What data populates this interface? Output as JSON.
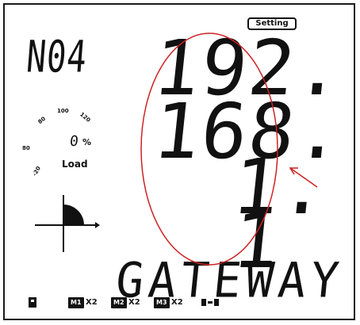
{
  "display": {
    "setting_badge": "Setting",
    "device_id": "N04",
    "ip_octets": [
      "192.",
      "168.",
      "1.",
      "1"
    ],
    "parameter_label": "GATEWAY"
  },
  "load_gauge": {
    "scale_labels": [
      "-20",
      "80",
      "80",
      "100",
      "120"
    ],
    "value": "0",
    "unit": "%",
    "label": "Load",
    "ring_color": "#cc2222"
  },
  "status_bar": {
    "meters": [
      {
        "chip": "M1",
        "multiplier": "X2"
      },
      {
        "chip": "M2",
        "multiplier": "X2"
      },
      {
        "chip": "M3",
        "multiplier": "X2"
      }
    ],
    "icons": [
      "device-status-icon",
      "comm-link-icon"
    ]
  },
  "annotation": {
    "highlight_color": "#cc2222",
    "shape": "ellipse-with-arrow"
  }
}
